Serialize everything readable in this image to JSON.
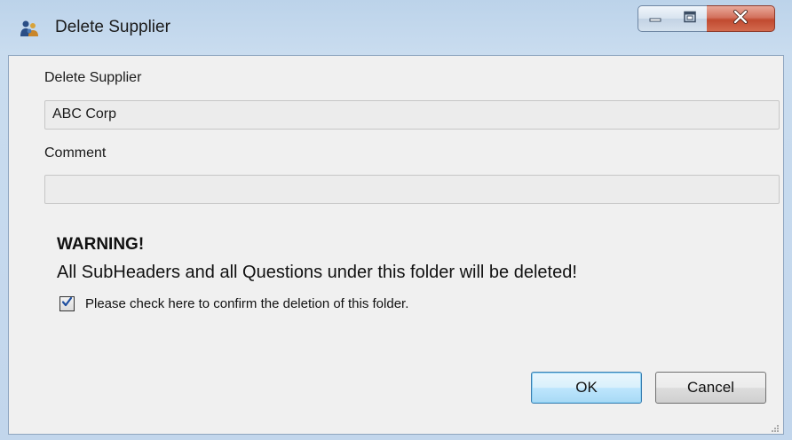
{
  "window": {
    "title": "Delete Supplier",
    "app_icon": "users-icon",
    "controls": {
      "minimize_icon": "minimize-icon",
      "maximize_icon": "maximize-icon",
      "close_icon": "close-icon"
    }
  },
  "form": {
    "supplier_label": "Delete Supplier",
    "supplier_value": "ABC Corp",
    "comment_label": "Comment",
    "comment_value": ""
  },
  "warning": {
    "title": "WARNING!",
    "message": "All SubHeaders and all Questions under this folder will be deleted!",
    "confirm_label": "Please check here to confirm the deletion of this folder.",
    "confirm_checked": true
  },
  "buttons": {
    "ok_label": "OK",
    "cancel_label": "Cancel"
  },
  "colors": {
    "title_bar": "#c2d6ec",
    "client_bg": "#f0f0f0",
    "close_button": "#c14a30",
    "ok_button_border": "#3c7fb1",
    "check_mark": "#1f4fa0"
  }
}
